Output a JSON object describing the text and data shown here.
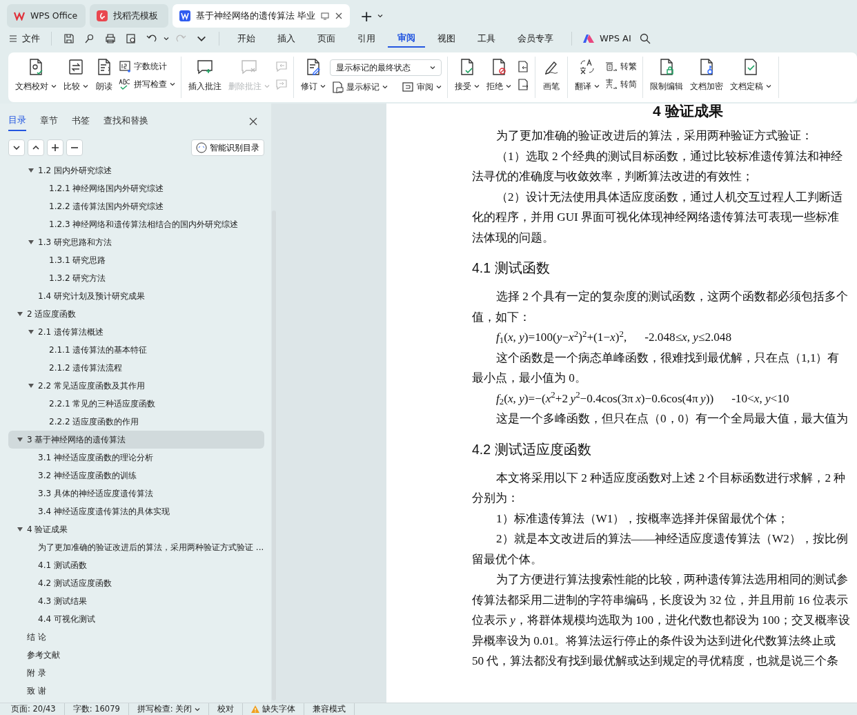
{
  "titlebar": {
    "tabs": [
      {
        "label": "WPS Office",
        "selected": false
      },
      {
        "label": "找稻壳模板",
        "selected": false
      },
      {
        "label": "基于神经网络的遗传算法 毕业",
        "selected": true
      }
    ],
    "new_tab": "+"
  },
  "menubar": {
    "file": "文件",
    "tabs": [
      {
        "label": "开始",
        "selected": false
      },
      {
        "label": "插入",
        "selected": false
      },
      {
        "label": "页面",
        "selected": false
      },
      {
        "label": "引用",
        "selected": false
      },
      {
        "label": "审阅",
        "selected": true
      },
      {
        "label": "视图",
        "selected": false
      },
      {
        "label": "工具",
        "selected": false
      },
      {
        "label": "会员专享",
        "selected": false
      }
    ],
    "ai": "WPS AI"
  },
  "ribbon": {
    "groups": [
      {
        "items": [
          {
            "kind": "large",
            "label": "文档校对",
            "dropdown": true,
            "disabled": false
          },
          {
            "kind": "large",
            "label": "比较",
            "dropdown": true,
            "disabled": false
          },
          {
            "kind": "large",
            "label": "朗读",
            "dropdown": false,
            "disabled": false
          },
          {
            "kind": "stack",
            "items": [
              {
                "label": "字数统计",
                "dropdown": false,
                "disabled": false
              },
              {
                "label": "拼写检查",
                "dropdown": true,
                "disabled": false
              }
            ]
          }
        ]
      },
      {
        "items": [
          {
            "kind": "large",
            "label": "插入批注",
            "dropdown": false,
            "disabled": false
          },
          {
            "kind": "large",
            "label": "删除批注",
            "dropdown": true,
            "disabled": true
          },
          {
            "kind": "iconstack",
            "items": [
              {
                "disabled": true
              },
              {
                "disabled": true
              }
            ]
          }
        ]
      },
      {
        "items": [
          {
            "kind": "large",
            "label": "修订",
            "dropdown": true,
            "disabled": false
          },
          {
            "kind": "selectstack",
            "value": "显示标记的最终状态",
            "items": [
              {
                "label": "显示标记",
                "dropdown": true,
                "disabled": false
              },
              {
                "label": "审阅",
                "dropdown": true,
                "disabled": false
              }
            ]
          }
        ]
      },
      {
        "items": [
          {
            "kind": "large",
            "label": "接受",
            "dropdown": true,
            "disabled": false
          },
          {
            "kind": "large",
            "label": "拒绝",
            "dropdown": true,
            "disabled": false
          },
          {
            "kind": "iconstack",
            "items": [
              {
                "disabled": false
              },
              {
                "disabled": false
              }
            ]
          }
        ]
      },
      {
        "items": [
          {
            "kind": "large",
            "label": "画笔",
            "dropdown": false,
            "disabled": false
          }
        ]
      },
      {
        "items": [
          {
            "kind": "large",
            "label": "翻译",
            "dropdown": true,
            "disabled": false
          },
          {
            "kind": "stack",
            "items": [
              {
                "label": "转繁",
                "dropdown": false,
                "disabled": false
              },
              {
                "label": "转简",
                "dropdown": false,
                "disabled": false
              }
            ]
          }
        ]
      },
      {
        "items": [
          {
            "kind": "large",
            "label": "限制编辑",
            "dropdown": false,
            "disabled": false
          },
          {
            "kind": "large",
            "label": "文档加密",
            "dropdown": false,
            "disabled": false
          },
          {
            "kind": "large",
            "label": "文档定稿",
            "dropdown": true,
            "disabled": false
          }
        ]
      }
    ]
  },
  "sidebar": {
    "tabs": [
      {
        "label": "目录",
        "selected": true
      },
      {
        "label": "章节",
        "selected": false
      },
      {
        "label": "书签",
        "selected": false
      },
      {
        "label": "查找和替换",
        "selected": false
      }
    ],
    "smart_button": "智能识别目录",
    "toc": [
      {
        "children": [
          {
            "label": "1.2  国内外研究综述",
            "expanded": true,
            "selected": false,
            "children": [
              {
                "label": "1.2.1  神经网络国内外研究综述",
                "selected": false
              },
              {
                "label": "1.2.2  遗传算法国内外研究综述",
                "selected": false
              },
              {
                "label": "1.2.3  神经网络和遗传算法相结合的国内外研究综述",
                "selected": false
              }
            ]
          },
          {
            "label": "1.3  研究思路和方法",
            "expanded": true,
            "selected": false,
            "children": [
              {
                "label": "1.3.1  研究思路",
                "selected": false
              },
              {
                "label": "1.3.2  研究方法",
                "selected": false
              }
            ]
          },
          {
            "label": "1.4 研究计划及预计研究成果",
            "selected": false
          }
        ]
      },
      {
        "label": "2  适应度函数",
        "expanded": true,
        "selected": false,
        "children": [
          {
            "label": "2.1  遗传算法概述",
            "expanded": true,
            "selected": false,
            "children": [
              {
                "label": "2.1.1  遗传算法的基本特征",
                "selected": false
              },
              {
                "label": "2.1.2  遗传算法流程",
                "selected": false
              }
            ]
          },
          {
            "label": "2.2  常见适应度函数及其作用",
            "expanded": true,
            "selected": false,
            "children": [
              {
                "label": "2.2.1  常见的三种适应度函数",
                "selected": false
              },
              {
                "label": "2.2.2  适应度函数的作用",
                "selected": false
              }
            ]
          }
        ]
      },
      {
        "label": "3  基于神经网络的遗传算法",
        "expanded": true,
        "selected": true,
        "children": [
          {
            "label": "3.1  神经适应度函数的理论分析",
            "selected": false
          },
          {
            "label": "3.2  神经适应度函数的训练",
            "selected": false
          },
          {
            "label": "3.3  具体的神经适应度遗传算法",
            "selected": false
          },
          {
            "label": "3.4  神经适应度遗传算法的具体实现",
            "selected": false
          }
        ]
      },
      {
        "label": "4  验证成果",
        "expanded": true,
        "selected": false,
        "children": [
          {
            "label": "为了更加准确的验证改进后的算法，采用两种验证方式验证 ...",
            "selected": false
          },
          {
            "label": "4.1  测试函数",
            "selected": false
          },
          {
            "label": "4.2  测试适应度函数",
            "selected": false
          },
          {
            "label": "4.3  测试结果",
            "selected": false
          },
          {
            "label": "4.4  可视化测试",
            "selected": false
          }
        ]
      },
      {
        "label": "结  论",
        "selected": false
      },
      {
        "label": "参考文献",
        "selected": false
      },
      {
        "label": "附  录",
        "selected": false
      },
      {
        "label": "致  谢",
        "selected": false
      }
    ]
  },
  "document": {
    "lines": [
      {
        "kind": "h1",
        "text": "4  验证成果"
      },
      {
        "kind": "first",
        "text": "为了更加准确的验证改进后的算法，采用两种验证方式验证："
      },
      {
        "kind": "first",
        "text": "（1）选取 2 个经典的测试目标函数，通过比较标准遗传算法和神经"
      },
      {
        "kind": "cont",
        "text": "法寻优的准确度与收敛效率，判断算法改进的有效性；"
      },
      {
        "kind": "first",
        "text": "（2）设计无法使用具体适应度函数，通过人机交互过程人工判断适"
      },
      {
        "kind": "cont",
        "text": "化的程序，并用 GUI 界面可视化体现神经网络遗传算法可表现一些标准"
      },
      {
        "kind": "cont",
        "text": "法体现的问题。"
      },
      {
        "kind": "h2",
        "text": "4.1  测试函数"
      },
      {
        "kind": "first",
        "text": "选择 2 个具有一定的复杂度的测试函数，这两个函数都必须包括多个"
      },
      {
        "kind": "cont",
        "text": "值，如下："
      },
      {
        "kind": "formula",
        "text": "*f*$_{1}$(*x*, *y*)=100(*y*−*x*$^{2}$)$^{2}$+(1−*x*)$^{2}$,",
        "range": "-2.048≤*x*, *y*≤2.048"
      },
      {
        "kind": "first",
        "text": "这个函数是一个病态单峰函数，很难找到最优解，只在点（1,1）有"
      },
      {
        "kind": "cont",
        "text": "最小点，最小值为 0。"
      },
      {
        "kind": "formula",
        "text": "*f*$_{2}$(*x*, *y*)=−(*x*$^{2}$+2 *y*$^{2}$−0.4cos(3π *x*)−0.6cos(4π *y*))",
        "range": "-10<*x*, *y*<10"
      },
      {
        "kind": "first",
        "text": "这是一个多峰函数，但只在点（0，0）有一个全局最大值，最大值为"
      },
      {
        "kind": "h2",
        "text": "4.2  测试适应度函数"
      },
      {
        "kind": "first",
        "text": "本文将采用以下 2 种适应度函数对上述 2 个目标函数进行求解，2 种"
      },
      {
        "kind": "cont",
        "text": "分别为："
      },
      {
        "kind": "first",
        "text": "1）标准遗传算法（W1），按概率选择并保留最优个体；"
      },
      {
        "kind": "first",
        "text": "2）就是本文改进后的算法——神经适应度遗传算法（W2），按比例"
      },
      {
        "kind": "cont",
        "text": "留最优个体。"
      },
      {
        "kind": "first",
        "text": "为了方便进行算法搜索性能的比较，两种遗传算法选用相同的测试参"
      },
      {
        "kind": "cont",
        "text": "传算法都采用二进制的字符串编码，长度设为 32 位，并且用前 16 位表示"
      },
      {
        "kind": "cont",
        "text": "位表示 *y*，将群体规模均选取为 100，进化代数也都设为 100；交叉概率设"
      },
      {
        "kind": "cont",
        "text": "异概率设为 0.01。将算法运行停止的条件设为达到进化代数算法终止或"
      },
      {
        "kind": "cont",
        "text": "50 代，算法都没有找到最优解或达到规定的寻优精度，也就是说三个条"
      }
    ]
  },
  "status_bar": [
    {
      "kind": "text",
      "text": "页面: 20/43"
    },
    {
      "kind": "text",
      "text": "字数: 16079"
    },
    {
      "kind": "dropdown",
      "text": "拼写检查: 关闭"
    },
    {
      "kind": "text",
      "text": "校对"
    },
    {
      "kind": "warning",
      "text": "缺失字体"
    },
    {
      "kind": "text",
      "text": "兼容模式"
    }
  ]
}
